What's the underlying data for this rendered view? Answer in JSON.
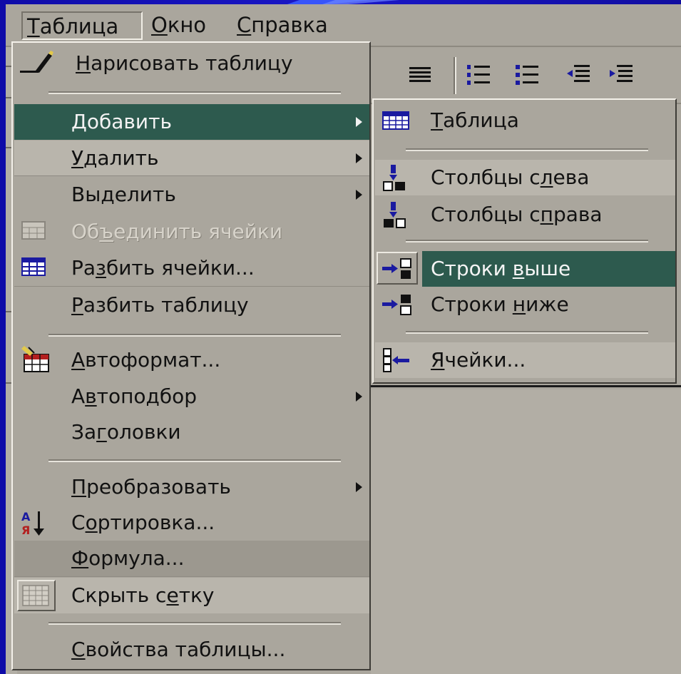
{
  "menubar": {
    "items": [
      {
        "mnemonic": "Т",
        "rest": "аблица"
      },
      {
        "mnemonic": "О",
        "rest": "кно"
      },
      {
        "mnemonic": "С",
        "rest": "правка"
      }
    ]
  },
  "table_menu": {
    "draw_table": {
      "pre": "",
      "key": "Н",
      "post": "арисовать таблицу",
      "icon": "pencil-icon"
    },
    "insert": {
      "pre": "",
      "key": "Д",
      "post": "обавить",
      "state": "highlighted"
    },
    "delete": {
      "pre": "",
      "key": "У",
      "post": "далить"
    },
    "select": {
      "pre": "Вы",
      "key": "д",
      "post": "елить"
    },
    "merge_cells": {
      "pre": "Об",
      "key": "ъ",
      "post": "единить ячейки",
      "state": "disabled",
      "icon": "merge-cells-icon"
    },
    "split_cells": {
      "pre": "Ра",
      "key": "з",
      "post": "бить ячейки...",
      "icon": "split-cells-icon"
    },
    "split_table": {
      "pre": "",
      "key": "Р",
      "post": "азбить таблицу"
    },
    "autoformat": {
      "pre": "",
      "key": "А",
      "post": "втоформат...",
      "icon": "autoformat-icon"
    },
    "autofit": {
      "pre": "А",
      "key": "в",
      "post": "топодбор"
    },
    "headings": {
      "pre": "За",
      "key": "г",
      "post": "оловки"
    },
    "convert": {
      "pre": "",
      "key": "П",
      "post": "реобразовать"
    },
    "sort": {
      "pre": "С",
      "key": "о",
      "post": "ртировка...",
      "icon": "sort-icon"
    },
    "formula": {
      "pre": "",
      "key": "Ф",
      "post": "ормула..."
    },
    "hide_gridlines": {
      "pre": "Скрыть с",
      "key": "е",
      "post": "тку",
      "icon": "gridlines-icon"
    },
    "table_properties": {
      "pre": "",
      "key": "С",
      "post": "войства таблицы..."
    }
  },
  "insert_submenu": {
    "table": {
      "pre": "",
      "key": "Т",
      "post": "аблица",
      "icon": "table-icon"
    },
    "columns_left": {
      "pre": "Столбцы с",
      "key": "л",
      "post": "ева",
      "icon": "columns-left-icon"
    },
    "columns_right": {
      "pre": "Столбцы с",
      "key": "п",
      "post": "рава",
      "icon": "columns-right-icon"
    },
    "rows_above": {
      "pre": "Строки ",
      "key": "в",
      "post": "ыше",
      "state": "highlighted",
      "icon": "rows-above-icon"
    },
    "rows_below": {
      "pre": "Строки ",
      "key": "н",
      "post": "иже",
      "icon": "rows-below-icon"
    },
    "cells": {
      "pre": "",
      "key": "Я",
      "post": "чейки...",
      "icon": "insert-cells-icon"
    }
  },
  "toolbar": {
    "buttons": [
      "justify-icon",
      "numbered-list-icon",
      "bulleted-list-icon",
      "decrease-indent-icon",
      "increase-indent-icon"
    ]
  },
  "colors": {
    "highlight": "#2d5a4e",
    "menu_face": "#aaa69d",
    "desktop": "#1a17c8"
  }
}
